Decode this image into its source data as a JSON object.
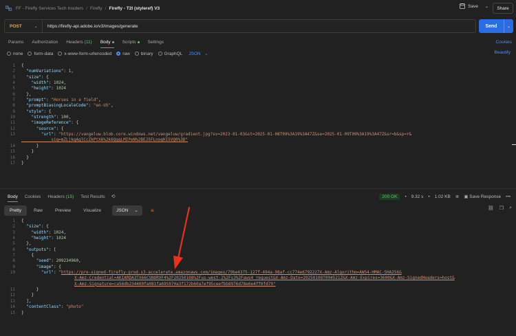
{
  "breadcrumb": {
    "items": [
      "FF - Firefly Services Tech Insiders",
      "Firefly"
    ],
    "current": "Firefly - T2I (styleref) V3"
  },
  "toolbar": {
    "save_label": "Save",
    "share_label": "Share"
  },
  "request": {
    "method": "POST",
    "url": "https://firefly-api.adobe.io/v3/images/generate",
    "send_label": "Send"
  },
  "req_tabs": {
    "params": "Params",
    "authorization": "Authorization",
    "headers": "Headers",
    "headers_count": "(11)",
    "body": "Body",
    "scripts": "Scripts",
    "settings": "Settings",
    "cookies": "Cookies"
  },
  "body_types": {
    "none": "none",
    "form_data": "form-data",
    "urlencoded": "x-www-form-urlencoded",
    "raw": "raw",
    "binary": "binary",
    "graphql": "GraphQL",
    "format": "JSON",
    "beautify": "Beautify"
  },
  "request_body": [
    "{",
    "  \"numVariations\": 1,",
    "  \"size\": {",
    "    \"width\": 1024,",
    "    \"height\": 1024",
    "  },",
    "  \"prompt\": \"Horses in a field\",",
    "  \"promptBiasingLocaleCode\": \"en-US\",",
    "  \"style\": {",
    "    \"strength\": 100,",
    "    \"imageReference\": {",
    "      \"source\": {",
    "        \"url\": \"https://vangeluw.blob.core.windows.net/vangeluw/gradient.jpg?sv=2023-01-03&st=2025-01-08T09%3A19%3A47Z&se=2025-01-09T09%3A19%3A47Z&sr=b&sp=r&",
    "            sig=mZLjkqAglCcZkPtX6%2k6QggLMIPeN%2BEJ5FLnoqHI5VQ0%3D\"",
    "      }",
    "    }",
    "  }",
    "}"
  ],
  "request_line_numbers": [
    "1",
    "2",
    "3",
    "4",
    "5",
    "6",
    "7",
    "8",
    "9",
    "10",
    "11",
    "12",
    "13",
    "",
    "14",
    "15",
    "16",
    "17"
  ],
  "resp_tabs": {
    "body": "Body",
    "cookies": "Cookies",
    "headers": "Headers",
    "headers_count": "(15)",
    "test_results": "Test Results"
  },
  "response_status": {
    "code": "200 OK",
    "time": "9.32 s",
    "size": "1.02 KB",
    "save_response": "Save Response"
  },
  "resp_toolbar": {
    "pretty": "Pretty",
    "raw": "Raw",
    "preview": "Preview",
    "visualize": "Visualize",
    "format": "JSON"
  },
  "response_body": [
    "{",
    "  \"size\": {",
    "    \"width\": 1024,",
    "    \"height\": 1024",
    "  },",
    "  \"outputs\": [",
    "    {",
    "      \"seed\": 209234960,",
    "      \"image\": {",
    "        \"url\": \"https://pre-signed-firefly-prod.s3-accelerate.amazonaws.com/images/79be4375-127f-494a-98af-cc774e6792227X-Amz-Algorithm=AWS4-HMAC-SHA256&",
    "X-Amz-Credential=AKIARDA3TX66CSNORXF4%2F20250108%2Fus-west-2%2Fs3%2Faws4_request&X-Amz-Date=20250108T094521Z&X-Amz-Expires=3600&X-Amz-SignedHeaders=host&",
    "X-Amz-Signature=ca56db234400fa081fa695970a3f172b60a7ef95ceefbb8976d78e6e4ff0fd79\"",
    "      }",
    "    }",
    "  ],",
    "  \"contentClass\": \"photo\"",
    "}"
  ],
  "response_line_numbers": [
    "1",
    "2",
    "3",
    "4",
    "5",
    "6",
    "7",
    "8",
    "9",
    "10",
    "",
    "",
    "11",
    "12",
    "13",
    "14",
    "15"
  ],
  "colors": {
    "accent": "#f26b3a",
    "send": "#2a6de3",
    "method": "#e3a94b",
    "ok": "#5fc26a",
    "arrow": "#e8321e"
  }
}
